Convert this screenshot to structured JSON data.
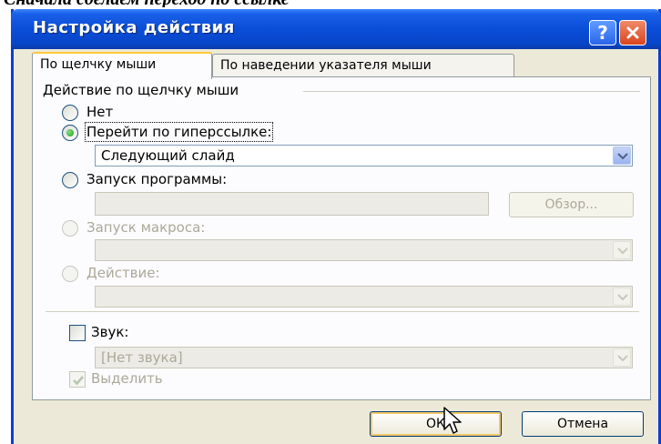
{
  "caption": "Сначала сделаем переход по ссылке",
  "window": {
    "title": "Настройка действия",
    "help_symbol": "?"
  },
  "tabs": [
    {
      "label": "По щелчку мыши",
      "active": true
    },
    {
      "label": "По наведении указателя мыши",
      "active": false
    }
  ],
  "group_label": "Действие по щелчку мыши",
  "options": {
    "none": "Нет",
    "hyperlink": "Перейти по гиперссылке:",
    "hyperlink_value": "Следующий слайд",
    "run_program": "Запуск программы:",
    "browse": "Обзор...",
    "run_macro": "Запуск макроса:",
    "action": "Действие:"
  },
  "selected_option": "hyperlink",
  "sound": {
    "label": "Звук:",
    "value": "[Нет звука]",
    "checked": false
  },
  "highlight": {
    "label": "Выделить",
    "checked": true
  },
  "buttons": {
    "ok": "ОК",
    "cancel": "Отмена"
  },
  "colors": {
    "title_bar": "#0a4ed8",
    "dialog_bg": "#ece9d8",
    "panel_bg": "#fcfcfe",
    "disabled_text": "#aca899",
    "close_button": "#d9451e"
  }
}
